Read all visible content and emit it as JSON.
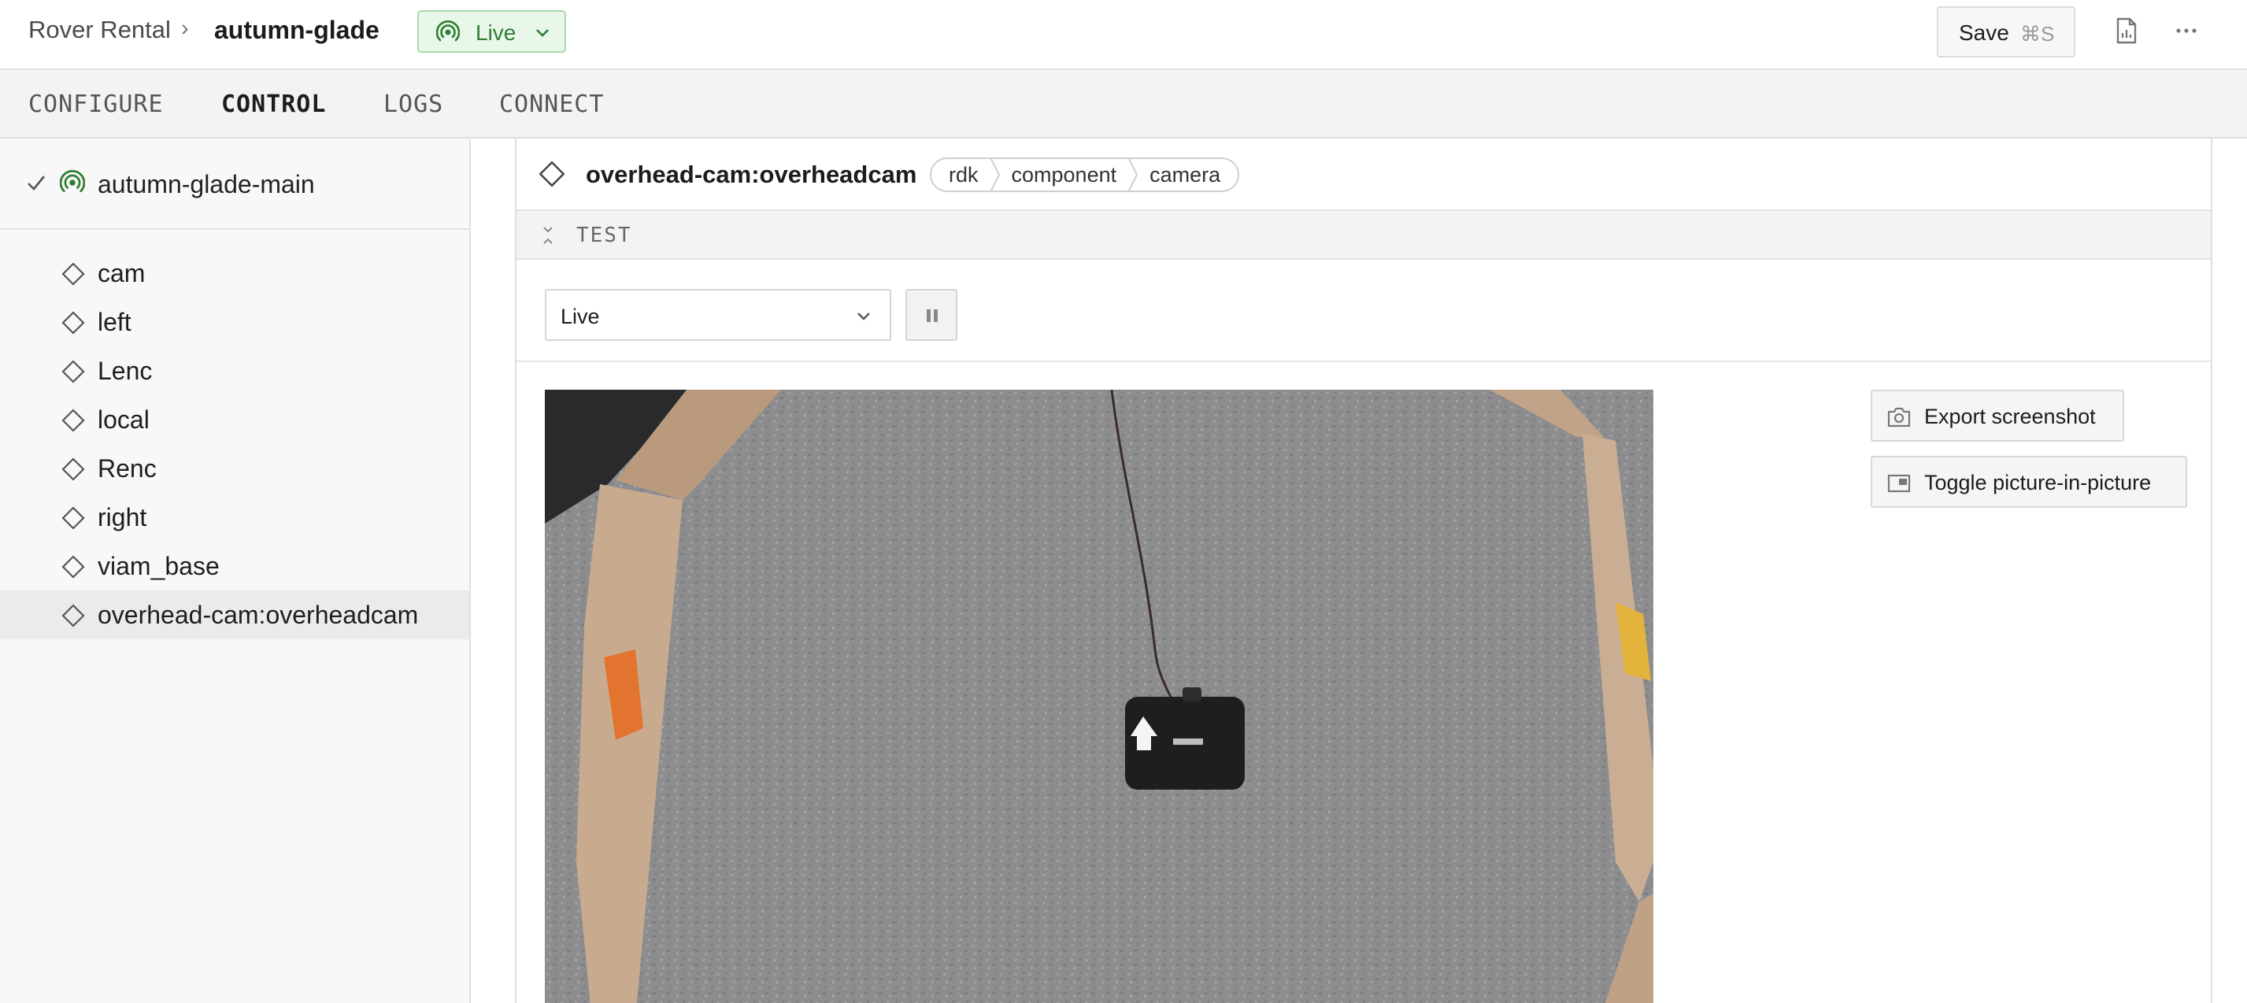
{
  "header": {
    "org_name": "Rover Rental",
    "breadcrumb_separator": "›",
    "robot_name": "autumn-glade",
    "status_label": "Live",
    "status_color": "#2e7d32",
    "save_label": "Save",
    "save_shortcut": "⌘S",
    "icons": [
      "live-signal-icon",
      "chevron-down-icon",
      "document-chart-icon",
      "more-horizontal-icon"
    ]
  },
  "tabs": [
    {
      "label": "CONFIGURE",
      "active": false
    },
    {
      "label": "CONTROL",
      "active": true
    },
    {
      "label": "LOGS",
      "active": false
    },
    {
      "label": "CONNECT",
      "active": false
    }
  ],
  "sidebar": {
    "robot_part": "autumn-glade-main",
    "components": [
      {
        "label": "cam"
      },
      {
        "label": "left"
      },
      {
        "label": "Lenc"
      },
      {
        "label": "local"
      },
      {
        "label": "Renc"
      },
      {
        "label": "right"
      },
      {
        "label": "viam_base"
      },
      {
        "label": "overhead-cam:overheadcam",
        "selected": true
      }
    ]
  },
  "panel": {
    "title": "overhead-cam:overheadcam",
    "api": [
      "rdk",
      "component",
      "camera"
    ],
    "section_label": "TEST",
    "mode_value": "Live",
    "export_label": "Export screenshot",
    "pip_label": "Toggle picture-in-picture"
  },
  "colors": {
    "accent_green": "#2e7d32",
    "badge_bg": "#e9f6ea",
    "tape_orange": "#e2742f",
    "tape_yellow": "#e4b33c"
  }
}
